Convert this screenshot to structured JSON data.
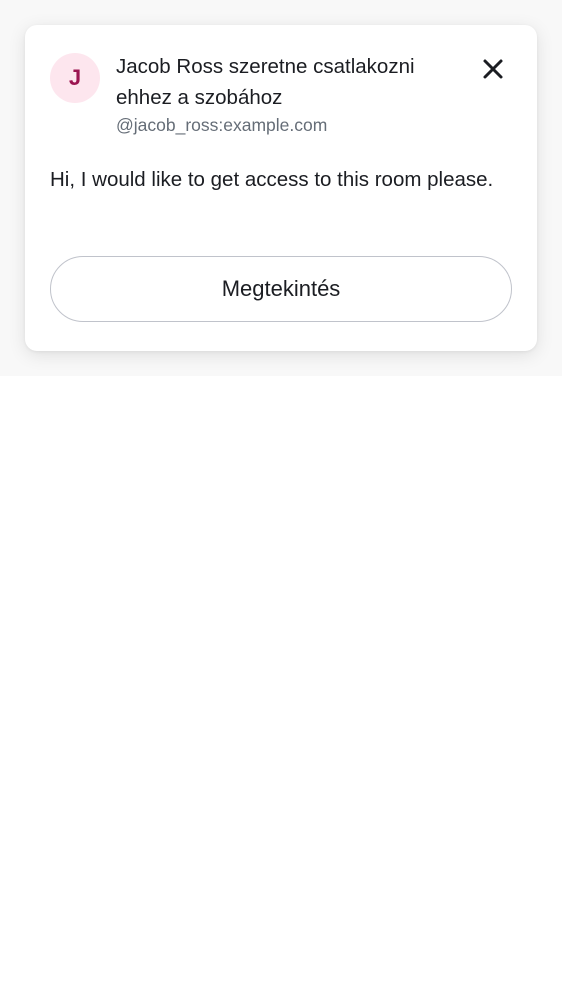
{
  "join_request": {
    "avatar_initial": "J",
    "title": "Jacob Ross szeretne csatlakozni ehhez a szobához",
    "user_id": "@jacob_ross:example.com",
    "message": "Hi, I would like to get access to this room please.",
    "view_button_label": "Megtekintés",
    "close_icon": "close-icon"
  },
  "colors": {
    "avatar_bg": "#fde6ee",
    "avatar_text": "#9b1450",
    "text_primary": "#1b1d22",
    "text_secondary": "#656d77",
    "button_border": "#c0c3cb"
  }
}
